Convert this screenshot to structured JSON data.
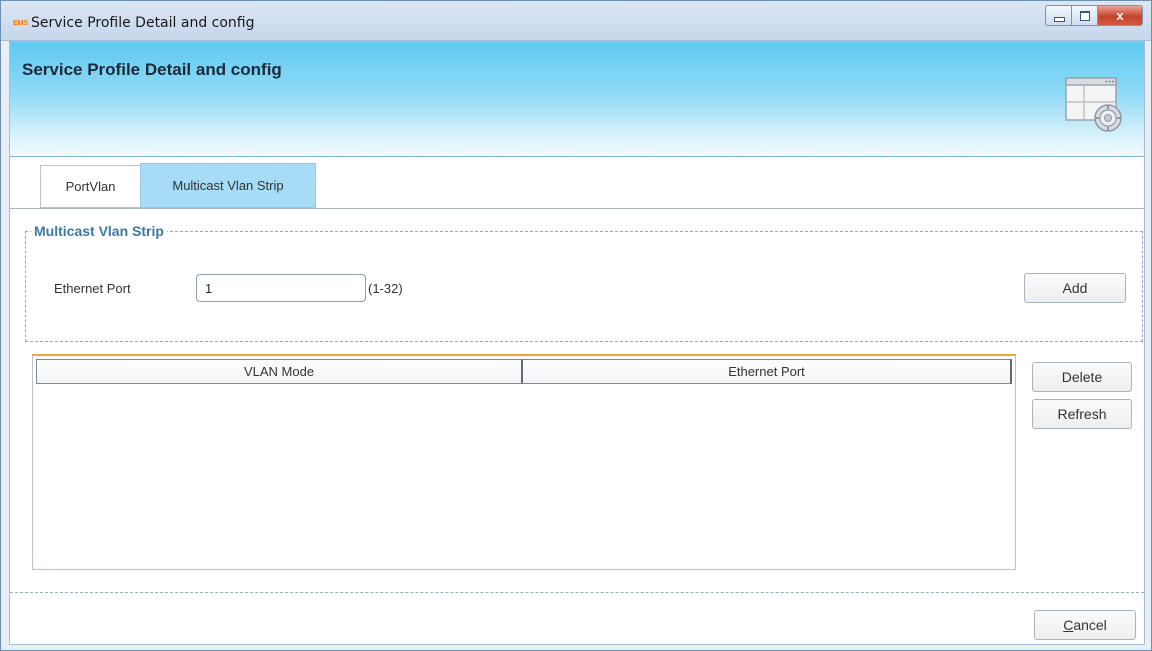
{
  "window": {
    "title": "Service Profile Detail and config",
    "app_icon_text": "EMS",
    "close_symbol": "x"
  },
  "header": {
    "title": "Service Profile Detail and config",
    "icon": "settings-window-icon"
  },
  "tabs": [
    {
      "label": "PortVlan",
      "active": false
    },
    {
      "label": "Multicast Vlan Strip",
      "active": true
    }
  ],
  "group": {
    "legend": "Multicast Vlan Strip",
    "ethernet_port_label": "Ethernet Port",
    "ethernet_port_value": "1",
    "range_hint": "(1-32)",
    "add_label": "Add"
  },
  "table": {
    "columns": [
      "VLAN Mode",
      "Ethernet Port"
    ],
    "rows": []
  },
  "actions": {
    "delete_label": "Delete",
    "refresh_label": "Refresh",
    "cancel_mnemonic": "C",
    "cancel_rest": "ancel"
  },
  "colors": {
    "header_gradient_top": "#5fc9f1",
    "active_tab": "#a7dcf6",
    "legend_text": "#3b7aa3",
    "table_accent": "#f0a33c"
  }
}
